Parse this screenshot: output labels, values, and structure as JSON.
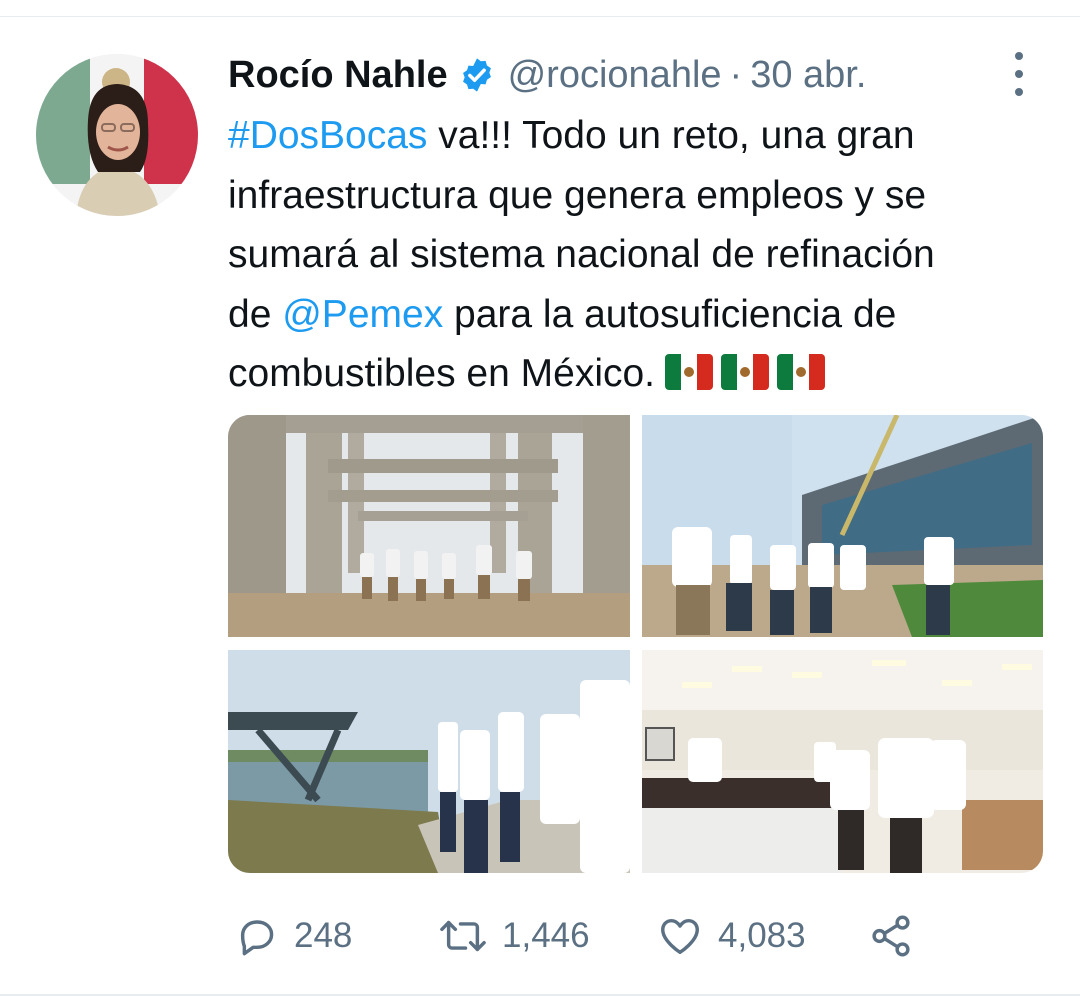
{
  "tweet": {
    "author_name": "Rocío Nahle",
    "handle": "@rocionahle",
    "separator": "·",
    "date": "30 abr.",
    "text_lines": [
      {
        "parts": [
          {
            "text": "#DosBocas",
            "link": true
          },
          {
            "text": " va!!! Todo un reto, una gran",
            "link": false
          }
        ]
      },
      {
        "parts": [
          {
            "text": "infraestructura que genera empleos y se",
            "link": false
          }
        ]
      },
      {
        "parts": [
          {
            "text": "sumará al sistema nacional de refinación",
            "link": false
          }
        ]
      },
      {
        "parts": [
          {
            "text": "de ",
            "link": false
          },
          {
            "text": "@Pemex",
            "link": true
          },
          {
            "text": " para la autosuficiencia de",
            "link": false
          }
        ]
      },
      {
        "parts": [
          {
            "text": "combustibles en México.",
            "link": false
          }
        ]
      }
    ],
    "flag_emoji_count": 3
  },
  "actions": {
    "reply_count": "248",
    "retweet_count": "1,446",
    "like_count": "4,083"
  },
  "colors": {
    "link": "#1d9bf0",
    "secondary_text": "#5b7083",
    "verified": "#1d9bf0"
  },
  "icons": {
    "verified": "verified-badge-icon",
    "more": "more-vertical-icon",
    "reply": "reply-icon",
    "retweet": "retweet-icon",
    "like": "heart-icon",
    "share": "share-icon"
  }
}
